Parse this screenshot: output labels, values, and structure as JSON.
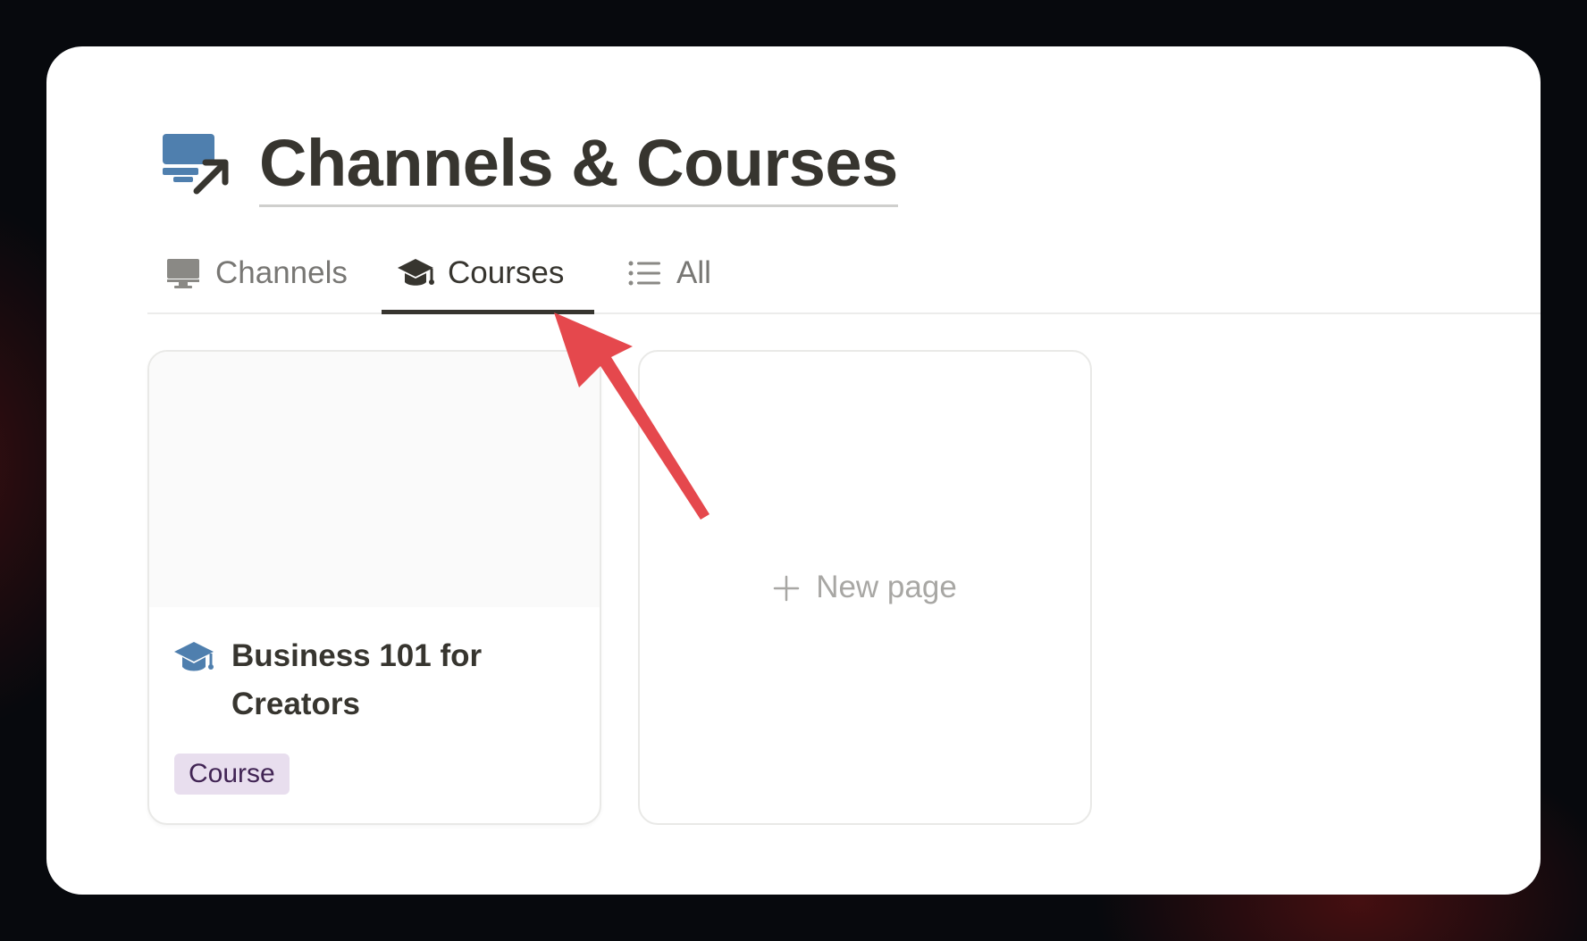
{
  "page": {
    "title": "Channels & Courses",
    "title_icon": "monitor-share-icon"
  },
  "tabs": [
    {
      "label": "Channels",
      "icon": "desktop-monitor-icon",
      "active": false
    },
    {
      "label": "Courses",
      "icon": "graduation-cap-icon",
      "active": true
    },
    {
      "label": "All",
      "icon": "list-icon",
      "active": false
    }
  ],
  "cards": [
    {
      "title": "Business 101 for Creators",
      "icon": "graduation-cap-icon",
      "tag": "Course"
    }
  ],
  "new_page": {
    "label": "New page",
    "icon": "plus-icon"
  },
  "colors": {
    "accent_blue": "#4f7fae",
    "text": "#37352f",
    "muted": "#787774",
    "annotation_red": "#e5484d",
    "tag_bg": "#e8deee"
  }
}
